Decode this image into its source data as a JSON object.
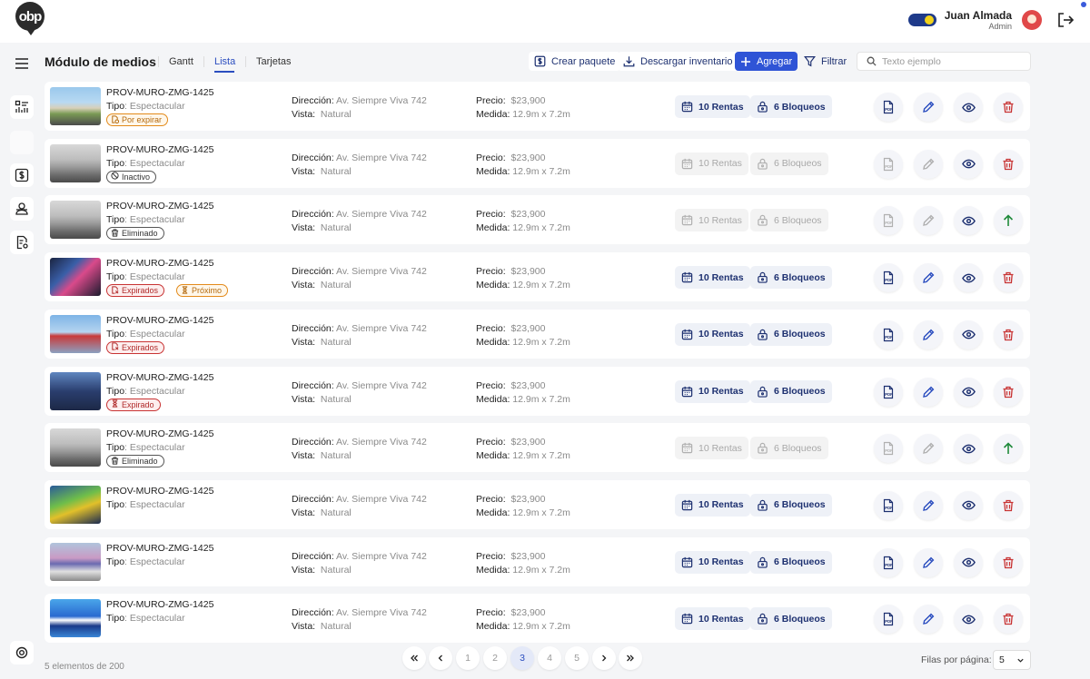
{
  "app": {
    "logo_text": "obp"
  },
  "user": {
    "name": "Juan Almada",
    "role": "Admin"
  },
  "header": {
    "title": "Módulo de medios",
    "tabs": [
      "Gantt",
      "Lista",
      "Tarjetas"
    ],
    "active_tab": "Lista",
    "actions": {
      "create_package": "Crear paquete",
      "download_inventory": "Descargar inventario",
      "add": "Agregar",
      "filter": "Filtrar"
    },
    "search_placeholder": "Texto ejemplo"
  },
  "labels": {
    "tipo": "Tipo",
    "direccion": "Dirección:",
    "vista": "Vista:",
    "precio": "Precio:",
    "medida": "Medida:"
  },
  "rows": [
    {
      "code": "PROV-MURO-ZMG-1425",
      "tipo": ": Espectacular",
      "direccion": "Av. Siempre Viva 742",
      "vista": "Natural",
      "precio": "$23,900",
      "medida": "12.9m x 7.2m",
      "rentas": "10 Rentas",
      "bloqueos": "6 Bloqueos",
      "badges": [
        {
          "text": "Por expirar",
          "color": "orange",
          "icon": "document-clock-icon"
        }
      ],
      "enabled": true,
      "action": "delete",
      "image": "street"
    },
    {
      "code": "PROV-MURO-ZMG-1425",
      "tipo": ": Espectacular",
      "direccion": "Av. Siempre Viva 742",
      "vista": "Natural",
      "precio": "$23,900",
      "medida": "12.9m x 7.2m",
      "rentas": "10 Rentas",
      "bloqueos": "6 Bloqueos",
      "badges": [
        {
          "text": "Inactivo",
          "color": "gray",
          "icon": "ban-icon"
        }
      ],
      "enabled": false,
      "action": "delete",
      "image": "gray"
    },
    {
      "code": "PROV-MURO-ZMG-1425",
      "tipo": ": Espectacular",
      "direccion": "Av. Siempre Viva 742",
      "vista": "Natural",
      "precio": "$23,900",
      "medida": "12.9m x 7.2m",
      "rentas": "10 Rentas",
      "bloqueos": "6 Bloqueos",
      "badges": [
        {
          "text": "Eliminado",
          "color": "gray",
          "icon": "trash-icon"
        }
      ],
      "enabled": false,
      "action": "restore",
      "image": "gray"
    },
    {
      "code": "PROV-MURO-ZMG-1425",
      "tipo": ": Espectacular",
      "direccion": "Av. Siempre Viva 742",
      "vista": "Natural",
      "precio": "$23,900",
      "medida": "12.9m x 7.2m",
      "rentas": "10 Rentas",
      "bloqueos": "6 Bloqueos",
      "badges": [
        {
          "text": "Expirados",
          "color": "red",
          "icon": "document-x-icon"
        },
        {
          "text": "Próximo",
          "color": "orange",
          "icon": "hourglass-icon"
        }
      ],
      "enabled": true,
      "action": "delete",
      "image": "night"
    },
    {
      "code": "PROV-MURO-ZMG-1425",
      "tipo": ": Espectacular",
      "direccion": "Av. Siempre Viva 742",
      "vista": "Natural",
      "precio": "$23,900",
      "medida": "12.9m x 7.2m",
      "rentas": "10 Rentas",
      "bloqueos": "6 Bloqueos",
      "badges": [
        {
          "text": "Expirados",
          "color": "red",
          "icon": "document-x-icon"
        }
      ],
      "enabled": true,
      "action": "delete",
      "image": "sky"
    },
    {
      "code": "PROV-MURO-ZMG-1425",
      "tipo": ": Espectacular",
      "direccion": "Av. Siempre Viva 742",
      "vista": "Natural",
      "precio": "$23,900",
      "medida": "12.9m x 7.2m",
      "rentas": "10 Rentas",
      "bloqueos": "6 Bloqueos",
      "badges": [
        {
          "text": "Expirado",
          "color": "red",
          "icon": "hourglass-icon"
        }
      ],
      "enabled": true,
      "action": "delete",
      "image": "building"
    },
    {
      "code": "PROV-MURO-ZMG-1425",
      "tipo": ": Espectacular",
      "direccion": "Av. Siempre Viva 742",
      "vista": "Natural",
      "precio": "$23,900",
      "medida": "12.9m x 7.2m",
      "rentas": "10 Rentas",
      "bloqueos": "6 Bloqueos",
      "badges": [
        {
          "text": "Eliminado",
          "color": "gray",
          "icon": "trash-icon"
        }
      ],
      "enabled": false,
      "action": "restore",
      "image": "gray"
    },
    {
      "code": "PROV-MURO-ZMG-1425",
      "tipo": ": Espectacular",
      "direccion": "Av. Siempre Viva 742",
      "vista": "Natural",
      "precio": "$23,900",
      "medida": "12.9m x 7.2m",
      "rentas": "10 Rentas",
      "bloqueos": "6 Bloqueos",
      "badges": [],
      "enabled": true,
      "action": "delete",
      "image": "billboard"
    },
    {
      "code": "PROV-MURO-ZMG-1425",
      "tipo": ": Espectacular",
      "direccion": "Av. Siempre Viva 742",
      "vista": "Natural",
      "precio": "$23,900",
      "medida": "12.9m x 7.2m",
      "rentas": "10 Rentas",
      "bloqueos": "6 Bloqueos",
      "badges": [],
      "enabled": true,
      "action": "delete",
      "image": "street2"
    },
    {
      "code": "PROV-MURO-ZMG-1425",
      "tipo": ": Espectacular",
      "direccion": "Av. Siempre Viva 742",
      "vista": "Natural",
      "precio": "$23,900",
      "medida": "12.9m x 7.2m",
      "rentas": "10 Rentas",
      "bloqueos": "6 Bloqueos",
      "badges": [],
      "enabled": true,
      "action": "delete",
      "image": "pepsi"
    }
  ],
  "pagination": {
    "summary": "5 elementos de 200",
    "pages": [
      "1",
      "2",
      "3",
      "4",
      "5"
    ],
    "current": "3",
    "rows_per_page_label": "Filas por página:",
    "rows_per_page": "5"
  },
  "colors": {
    "accent": "#2f54d6",
    "primary_text": "#1d3070",
    "danger": "#c83333",
    "warning": "#e38a1a",
    "success": "#1f8a3a"
  }
}
